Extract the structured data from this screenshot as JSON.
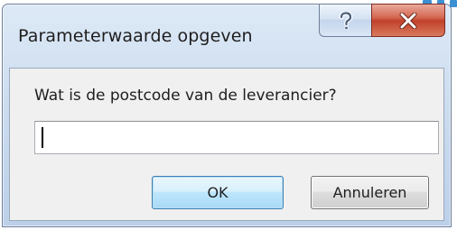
{
  "window": {
    "title": "Parameterwaarde opgeven",
    "help_icon": "question-mark-icon",
    "close_icon": "close-x-icon"
  },
  "dialog": {
    "prompt": "Wat is de postcode van de leverancier?",
    "input_value": "",
    "ok_label": "OK",
    "cancel_label": "Annuleren"
  },
  "colors": {
    "frame": "#c9daee",
    "close_button": "#c1412b",
    "default_button_border": "#3c7fb1",
    "client_background": "#f0f0f0"
  }
}
